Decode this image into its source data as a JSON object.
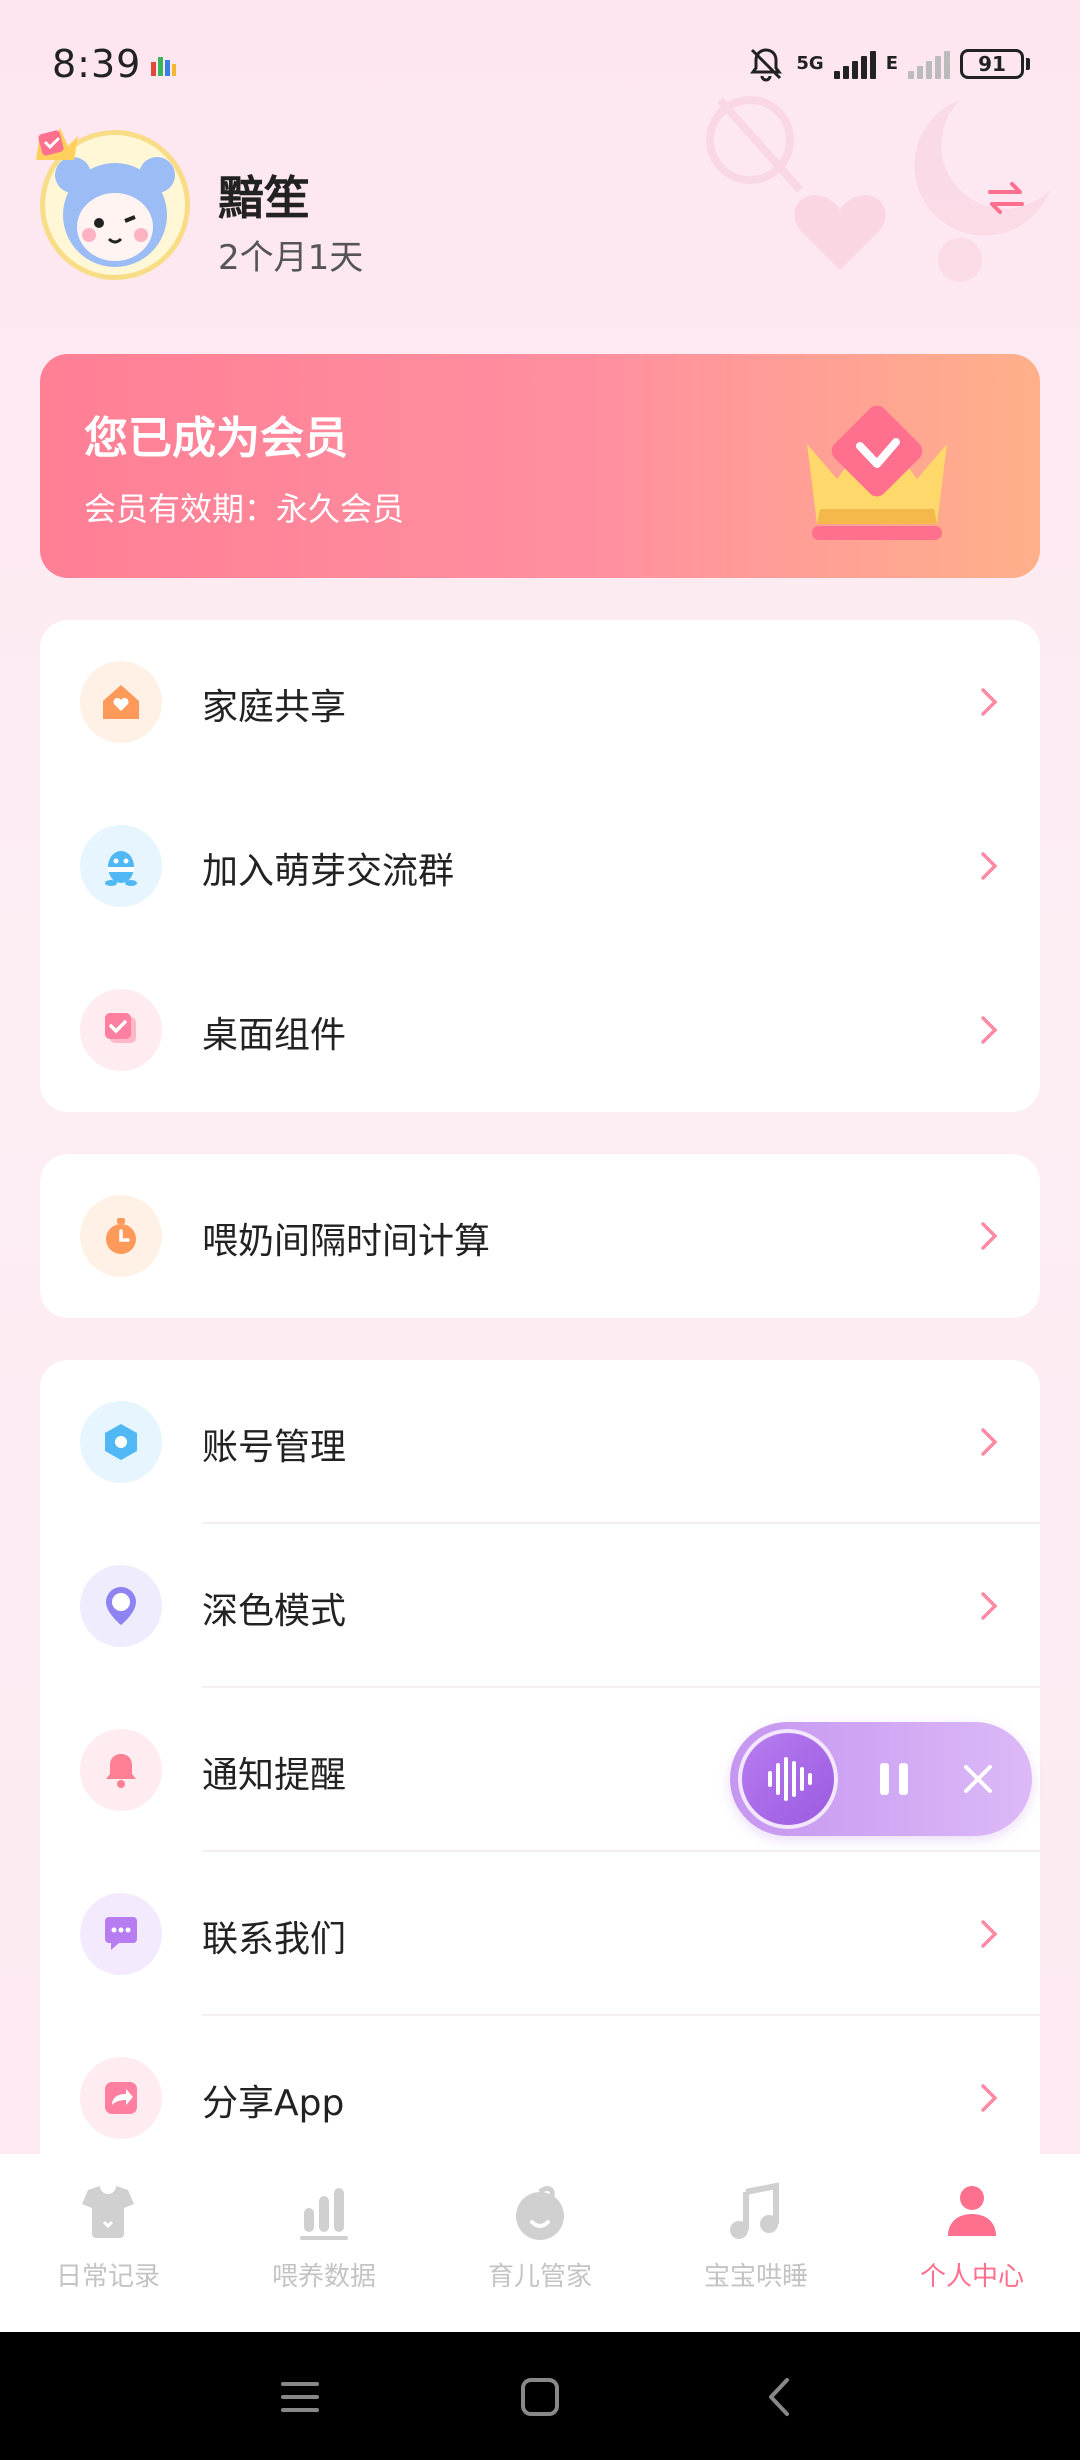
{
  "status_bar": {
    "time": "8:39",
    "network_1": "5G",
    "network_2": "E",
    "battery": "91"
  },
  "profile": {
    "name": "黯笙",
    "age": "2个月1天"
  },
  "membership": {
    "title": "您已成为会员",
    "validity": "会员有效期：永久会员"
  },
  "menu_group_1": [
    {
      "label": "家庭共享",
      "icon": "house-heart-icon",
      "color": "#ff9a5a"
    },
    {
      "label": "加入萌芽交流群",
      "icon": "qq-penguin-icon",
      "color": "#4fb8f5"
    },
    {
      "label": "桌面组件",
      "icon": "widget-check-icon",
      "color": "#ff7fa0"
    }
  ],
  "menu_group_2": [
    {
      "label": "喂奶间隔时间计算",
      "icon": "stopwatch-icon",
      "color": "#ff9a5a"
    }
  ],
  "menu_group_3": [
    {
      "label": "账号管理",
      "icon": "hexagon-gear-icon",
      "color": "#4fb8f5"
    },
    {
      "label": "深色模式",
      "icon": "location-pin-icon",
      "color": "#8f83f2"
    },
    {
      "label": "通知提醒",
      "icon": "bell-icon",
      "color": "#ff7f95"
    },
    {
      "label": "联系我们",
      "icon": "chat-bubble-icon",
      "color": "#b77cf0"
    },
    {
      "label": "分享App",
      "icon": "share-arrow-icon",
      "color": "#ff7fa0"
    }
  ],
  "bottom_nav": [
    {
      "label": "日常记录",
      "icon": "onesie-icon",
      "active": false
    },
    {
      "label": "喂养数据",
      "icon": "bar-chart-icon",
      "active": false
    },
    {
      "label": "育儿管家",
      "icon": "baby-face-icon",
      "active": false
    },
    {
      "label": "宝宝哄睡",
      "icon": "music-note-icon",
      "active": false
    },
    {
      "label": "个人中心",
      "icon": "person-icon",
      "active": true
    }
  ],
  "colors": {
    "accent_pink": "#ff6f8e",
    "member_gradient_start": "#ff7f95",
    "member_gradient_end": "#ffb08a",
    "inactive_nav": "#c4c4c4"
  }
}
